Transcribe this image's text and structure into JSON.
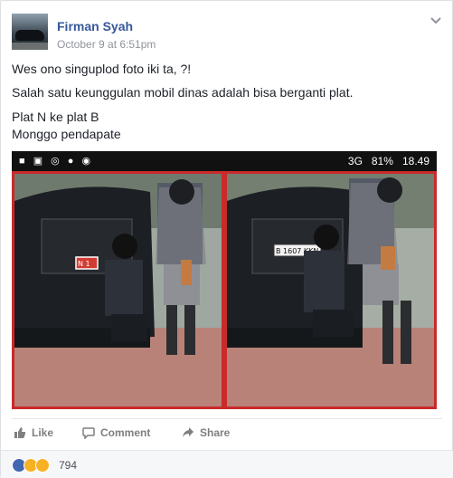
{
  "post": {
    "author": "Firman Syah",
    "timestamp": "October 9 at 6:51pm",
    "lines": [
      "Wes ono singuplod foto iki ta, ?!",
      "Salah satu keunggulan mobil dinas adalah bisa berganti plat.",
      "Plat N ke plat B",
      "Monggo pendapate"
    ]
  },
  "photo": {
    "statusbar": {
      "network": "3G",
      "battery": "81%",
      "time": "18.49"
    },
    "plate_left": "N 1 ",
    "plate_right": "B 1607 KKN"
  },
  "actions": {
    "like": "Like",
    "comment": "Comment",
    "share": "Share"
  },
  "reactions": {
    "count": "794"
  },
  "colors": {
    "link": "#365899",
    "frame": "#c92a2a",
    "like": "#4267b2"
  }
}
